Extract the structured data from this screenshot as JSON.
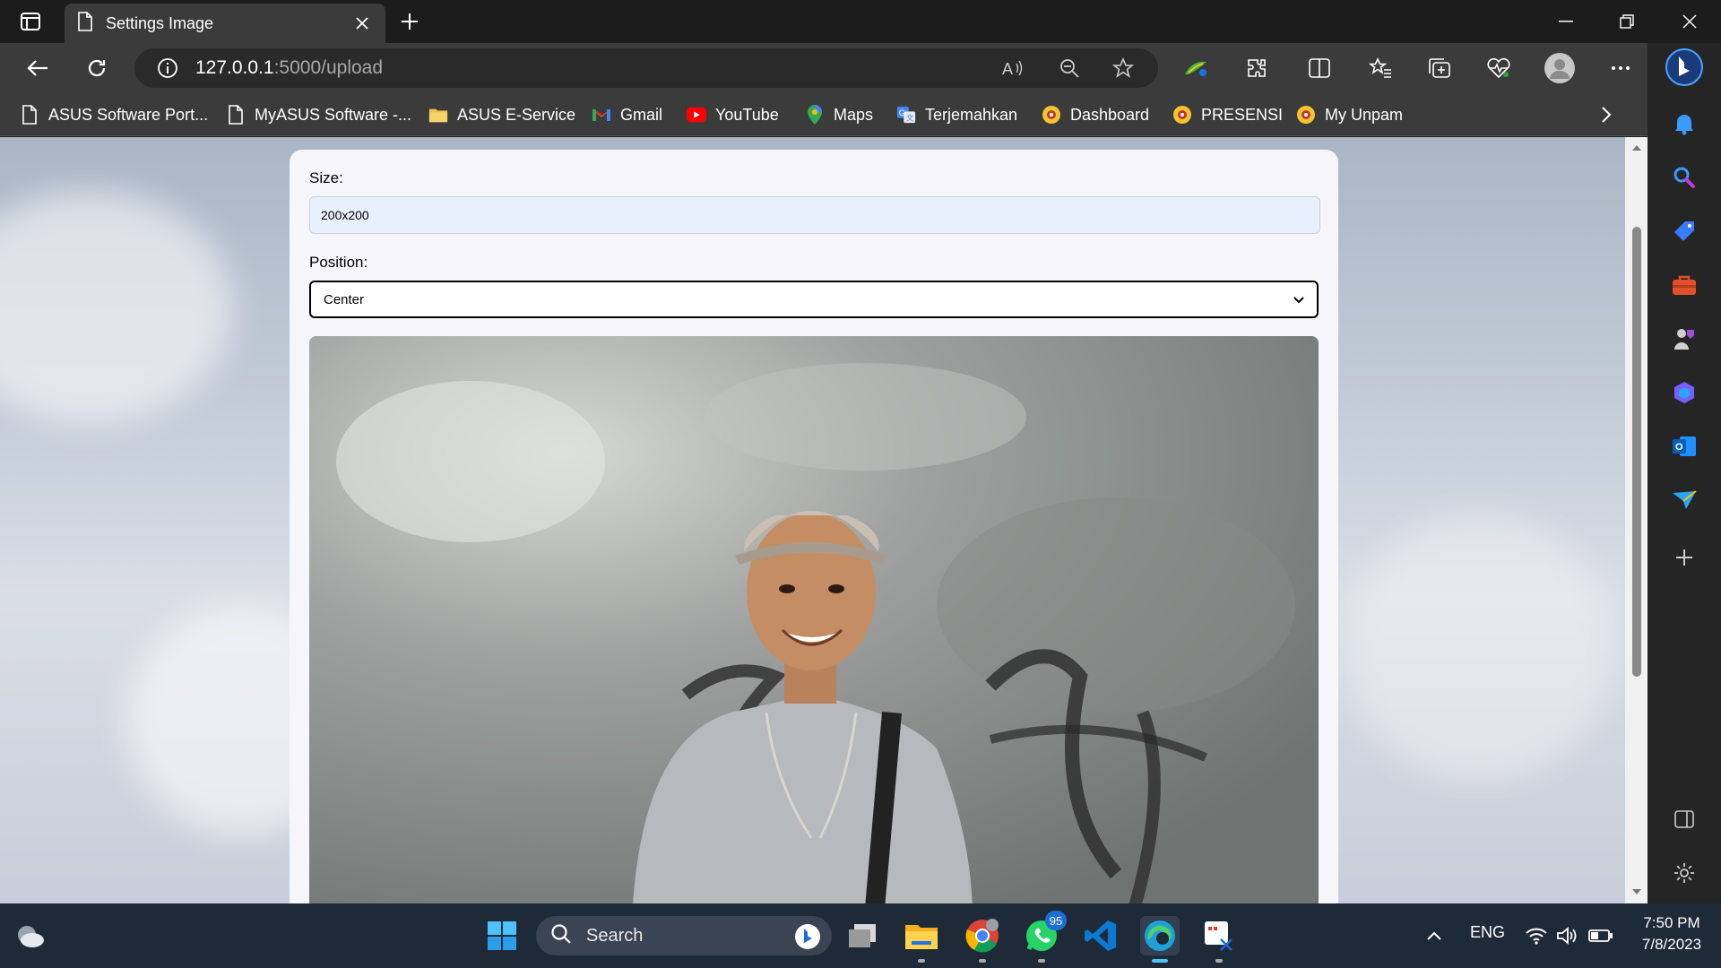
{
  "tab": {
    "title": "Settings Image"
  },
  "address": {
    "host": "127.0.0.1",
    "path": ":5000/upload"
  },
  "favorites": [
    {
      "label": "ASUS Software Port...",
      "icon": "page-icon"
    },
    {
      "label": "MyASUS Software -...",
      "icon": "page-icon"
    },
    {
      "label": "ASUS E-Service",
      "icon": "folder-icon"
    },
    {
      "label": "Gmail",
      "icon": "gmail-icon"
    },
    {
      "label": "YouTube",
      "icon": "youtube-icon"
    },
    {
      "label": "Maps",
      "icon": "maps-icon"
    },
    {
      "label": "Terjemahkan",
      "icon": "translate-icon"
    },
    {
      "label": "Dashboard",
      "icon": "unpam-icon"
    },
    {
      "label": "PRESENSI",
      "icon": "unpam-icon"
    },
    {
      "label": "My Unpam",
      "icon": "unpam-icon"
    }
  ],
  "form": {
    "size_label": "Size:",
    "size_value": "200x200",
    "position_label": "Position:",
    "position_value": "Center"
  },
  "taskbar": {
    "search_label": "Search",
    "whatsapp_badge": "95",
    "language": "ENG",
    "time": "7:50 PM",
    "date": "7/8/2023"
  }
}
